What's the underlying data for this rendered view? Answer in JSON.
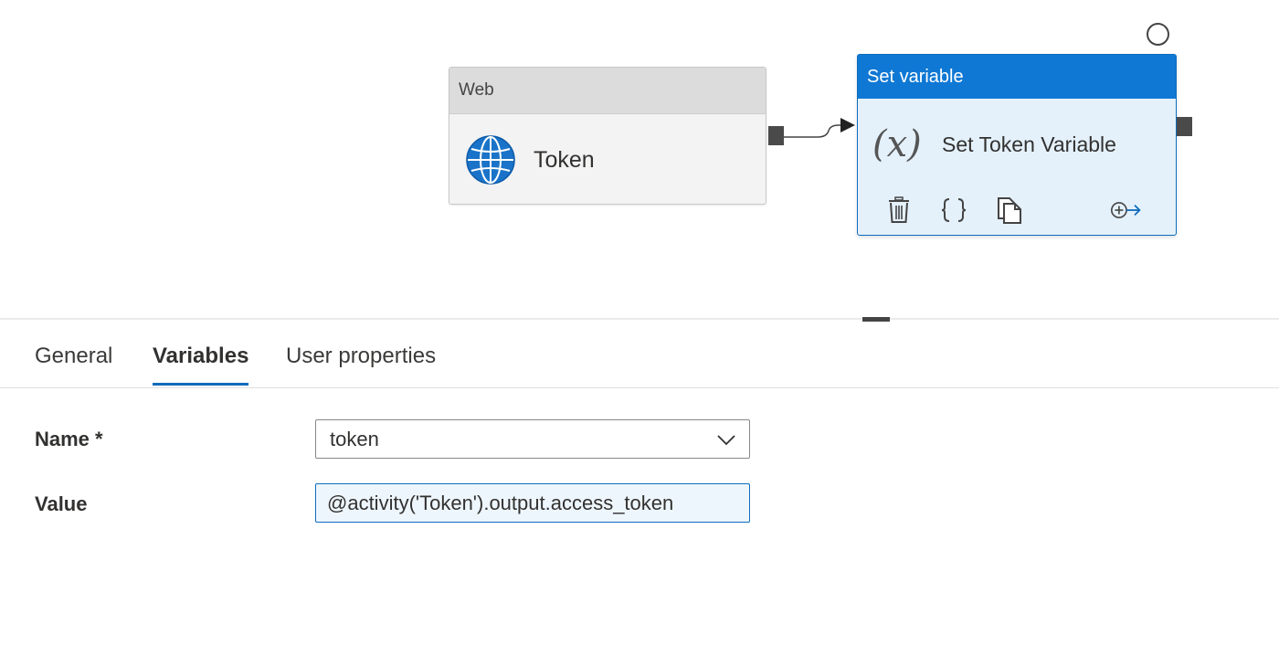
{
  "pipeline": {
    "web_activity": {
      "type_label": "Web",
      "name": "Token",
      "icon": "globe-icon"
    },
    "set_variable_activity": {
      "type_label": "Set variable",
      "name": "Set Token Variable",
      "icon": "fx-icon",
      "fx_symbol": "(x)",
      "actions": [
        "delete-icon",
        "code-icon",
        "copy-icon",
        "add-output-icon"
      ]
    }
  },
  "properties": {
    "tabs": [
      {
        "label": "General",
        "active": false
      },
      {
        "label": "Variables",
        "active": true
      },
      {
        "label": "User properties",
        "active": false
      }
    ],
    "fields": {
      "name_label": "Name *",
      "name_value": "token",
      "value_label": "Value",
      "value_value": "@activity('Token').output.access_token"
    }
  },
  "colors": {
    "accent": "#0f78d4",
    "selected_activity_bg": "#e4f1fb",
    "web_header_bg": "#dcdcdc",
    "port": "#4a4a4a"
  }
}
